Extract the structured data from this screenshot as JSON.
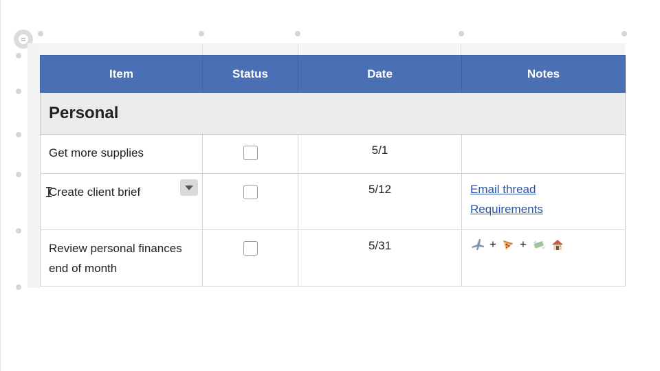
{
  "table": {
    "headers": [
      "Item",
      "Status",
      "Date",
      "Notes"
    ],
    "section_title": "Personal",
    "rows": [
      {
        "item": "Get more supplies",
        "checked": false,
        "date": "5/1",
        "notes": []
      },
      {
        "item": "Create client brief",
        "checked": false,
        "date": "5/12",
        "notes": [
          "Email thread",
          "Requirements"
        ]
      },
      {
        "item": "Review personal finances end of month",
        "checked": false,
        "date": "5/31",
        "notes_plus_1": "+",
        "notes_plus_2": "+"
      }
    ]
  },
  "icons": {
    "menu": "menu-icon",
    "dropdown": "chevron-down-icon",
    "cursor": "text-cursor-icon",
    "emoji_sequence": [
      "airplane-icon",
      "pizza-icon",
      "money-wings-icon",
      "house-icon"
    ]
  },
  "colors": {
    "header_bg": "#4a6fb5",
    "section_bg": "#ebebeb",
    "link": "#2a53a8"
  }
}
